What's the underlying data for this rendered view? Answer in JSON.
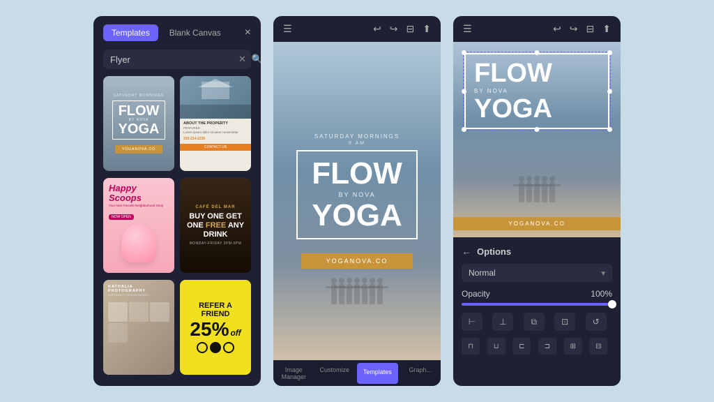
{
  "app": {
    "background": "#c8dce8"
  },
  "left_panel": {
    "tab_templates": "Templates",
    "tab_blank": "Blank Canvas",
    "search_value": "Flyer",
    "search_placeholder": "Flyer",
    "close_label": "×",
    "templates": [
      {
        "id": "yoga-flyer",
        "type": "yoga",
        "name": "Flow Yoga Flyer"
      },
      {
        "id": "house-flyer",
        "type": "house",
        "name": "House Listing Flyer"
      },
      {
        "id": "scoops-flyer",
        "type": "scoops",
        "name": "Happy Scoops Flyer"
      },
      {
        "id": "cafe-flyer",
        "type": "cafe",
        "name": "Cafe Del Mar Flyer"
      },
      {
        "id": "photo-flyer",
        "type": "photo",
        "name": "Photography Flyer"
      },
      {
        "id": "refer-flyer",
        "type": "refer",
        "name": "Refer a Friend Flyer"
      }
    ],
    "yoga_text": {
      "flow": "FLOW",
      "by": "BY NOVA",
      "yoga": "YOGA",
      "sub": "SATURDAY MORNINGS"
    },
    "scoops_text": {
      "title": "Happy Scoops",
      "sub": "Your New Favorite Neighborhood Shop"
    },
    "cafe_text": {
      "name": "CAFÉ DEL MAR",
      "main": "BUY ONE GET ONE FREE ANY DRINK"
    },
    "refer_text": {
      "line1": "REFER A",
      "line2": "FRIEND",
      "discount": "25%",
      "off": "off"
    }
  },
  "mid_panel": {
    "toolbar": {
      "undo": "↩",
      "redo": "↪",
      "print": "⊟",
      "share": "⬆",
      "menu": "☰"
    },
    "canvas": {
      "saturday": "SATURDAY MORNINGS",
      "nine_am": "9 AM",
      "flow": "FLOW",
      "by_nova": "BY NOVA",
      "yoga": "YOGA",
      "website": "YOGANOVA.CO"
    },
    "tabs": [
      {
        "label": "Image Manager",
        "active": false
      },
      {
        "label": "Customize",
        "active": false
      },
      {
        "label": "Templates",
        "active": true
      },
      {
        "label": "Graph...",
        "active": false
      }
    ]
  },
  "right_panel": {
    "toolbar": {
      "menu": "☰",
      "undo": "↩",
      "redo": "↪",
      "print": "⊟",
      "share": "⬆"
    },
    "canvas": {
      "flow": "FLOW",
      "by_nova": "BY NOVA",
      "yoga": "YOGA",
      "website": "YOGANOVA.CO"
    },
    "options": {
      "title": "Options",
      "back_label": "←",
      "blend_mode": "Normal",
      "opacity_label": "Opacity",
      "opacity_value": "100%",
      "icons_row1": [
        "⊢|⊣",
        "⊤⊥",
        "⧉",
        "⊡"
      ],
      "icons_row2": [
        "⊓",
        "⊔",
        "⊏",
        "⊐",
        "⊞",
        "⊟"
      ]
    }
  }
}
